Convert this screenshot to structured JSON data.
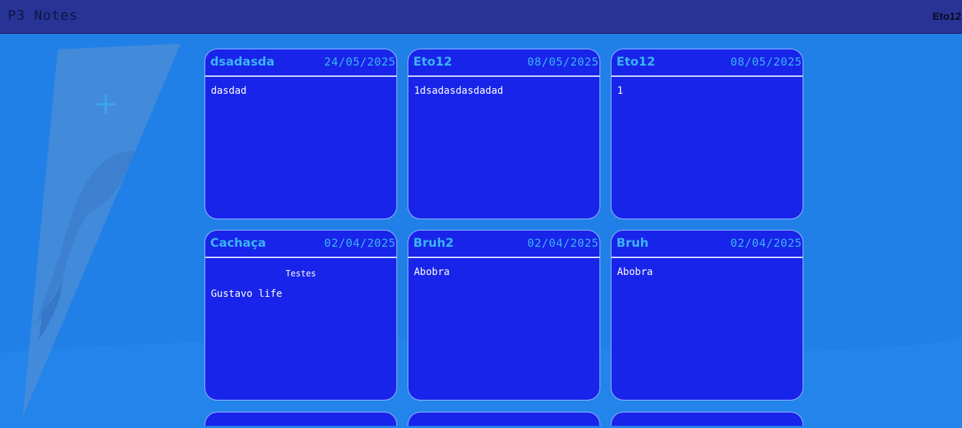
{
  "app": {
    "title": "P3 Notes",
    "user": "Eto12"
  },
  "sidebar": {
    "add_icon": "plus-icon"
  },
  "notes": [
    {
      "title": "dsadasda",
      "date": "24/05/2025",
      "heading": "",
      "body": "dasdad"
    },
    {
      "title": "Eto12",
      "date": "08/05/2025",
      "heading": "",
      "body": "1dsadasdasdadad"
    },
    {
      "title": "Eto12",
      "date": "08/05/2025",
      "heading": "",
      "body": "1"
    },
    {
      "title": "Cachaça",
      "date": "02/04/2025",
      "heading": "Testes",
      "body": "Gustavo life"
    },
    {
      "title": "Bruh2",
      "date": "02/04/2025",
      "heading": "",
      "body": "Abobra"
    },
    {
      "title": "Bruh",
      "date": "02/04/2025",
      "heading": "",
      "body": "Abobra"
    }
  ],
  "colors": {
    "background": "#2180e8",
    "topbar": "#283396",
    "card": "#1924ea",
    "card_title": "#38b6f4"
  }
}
